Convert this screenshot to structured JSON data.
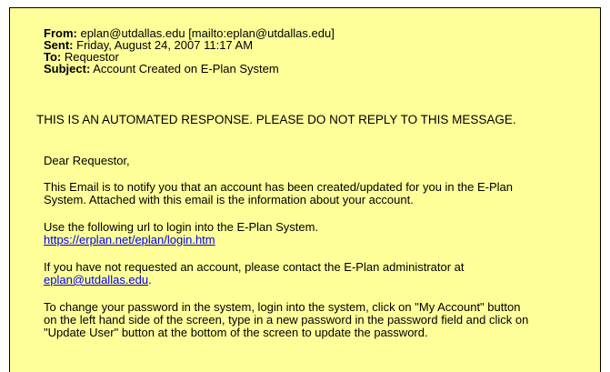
{
  "email": {
    "header": {
      "from_label": "From:",
      "from_value": "eplan@utdallas.edu [mailto:eplan@utdallas.edu]",
      "sent_label": "Sent:",
      "sent_value": "Friday, August 24, 2007 11:17 AM",
      "to_label": "To:",
      "to_value": "Requestor",
      "subject_label": "Subject:",
      "subject_value": "Account Created on E-Plan System"
    },
    "automated_notice": "THIS IS AN AUTOMATED RESPONSE. PLEASE DO NOT REPLY TO THIS MESSAGE.",
    "greeting": "Dear Requestor,",
    "para1_line1": "This Email is to notify you that an account has been created/updated for you in the E-Plan",
    "para1_line2": "System. Attached with this email is the information about your account.",
    "para2_line1": "Use the following url to login into the E-Plan System.",
    "login_url": "https://erplan.net/eplan/login.htm",
    "para3_line1": "If you have not requested an account, please contact the E-Plan administrator at",
    "admin_email": "eplan@utdallas.edu",
    "admin_email_suffix": ".",
    "para4_line1": "To change your password in the system, login into the system, click on \"My Account\" button",
    "para4_line2": "on the left hand side of the screen, type in a new password in the password field and click on",
    "para4_line3": "\"Update User\" button at the bottom of the screen to update the password."
  }
}
